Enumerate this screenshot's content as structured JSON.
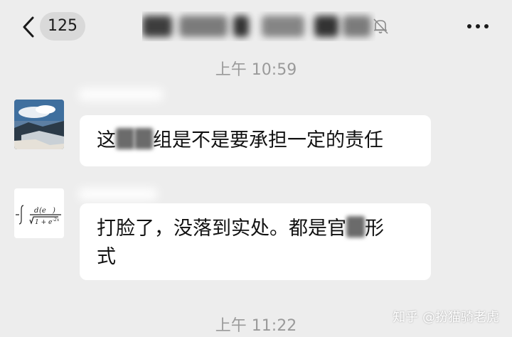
{
  "header": {
    "unread_count": "125",
    "more_label": "•••"
  },
  "messages": [
    {
      "time": "上午 10:59",
      "text_before": "这",
      "text_after": "组是不是要承担一定的责任"
    },
    {
      "line1_before": "打脸了，没落到实处。都是官",
      "line1_after": "形",
      "line2": "式"
    }
  ],
  "footer_time": "上午 11:22",
  "watermark": "知乎 @扮猫骑老虎",
  "colors": {
    "background": "#ededed",
    "bubble": "#ffffff",
    "timestamp": "#9a9a9a",
    "badge": "#d9d9d9"
  },
  "icons": [
    "back-chevron-icon",
    "mute-bell-icon",
    "more-dots-icon",
    "landscape-avatar-icon",
    "formula-avatar-icon"
  ]
}
